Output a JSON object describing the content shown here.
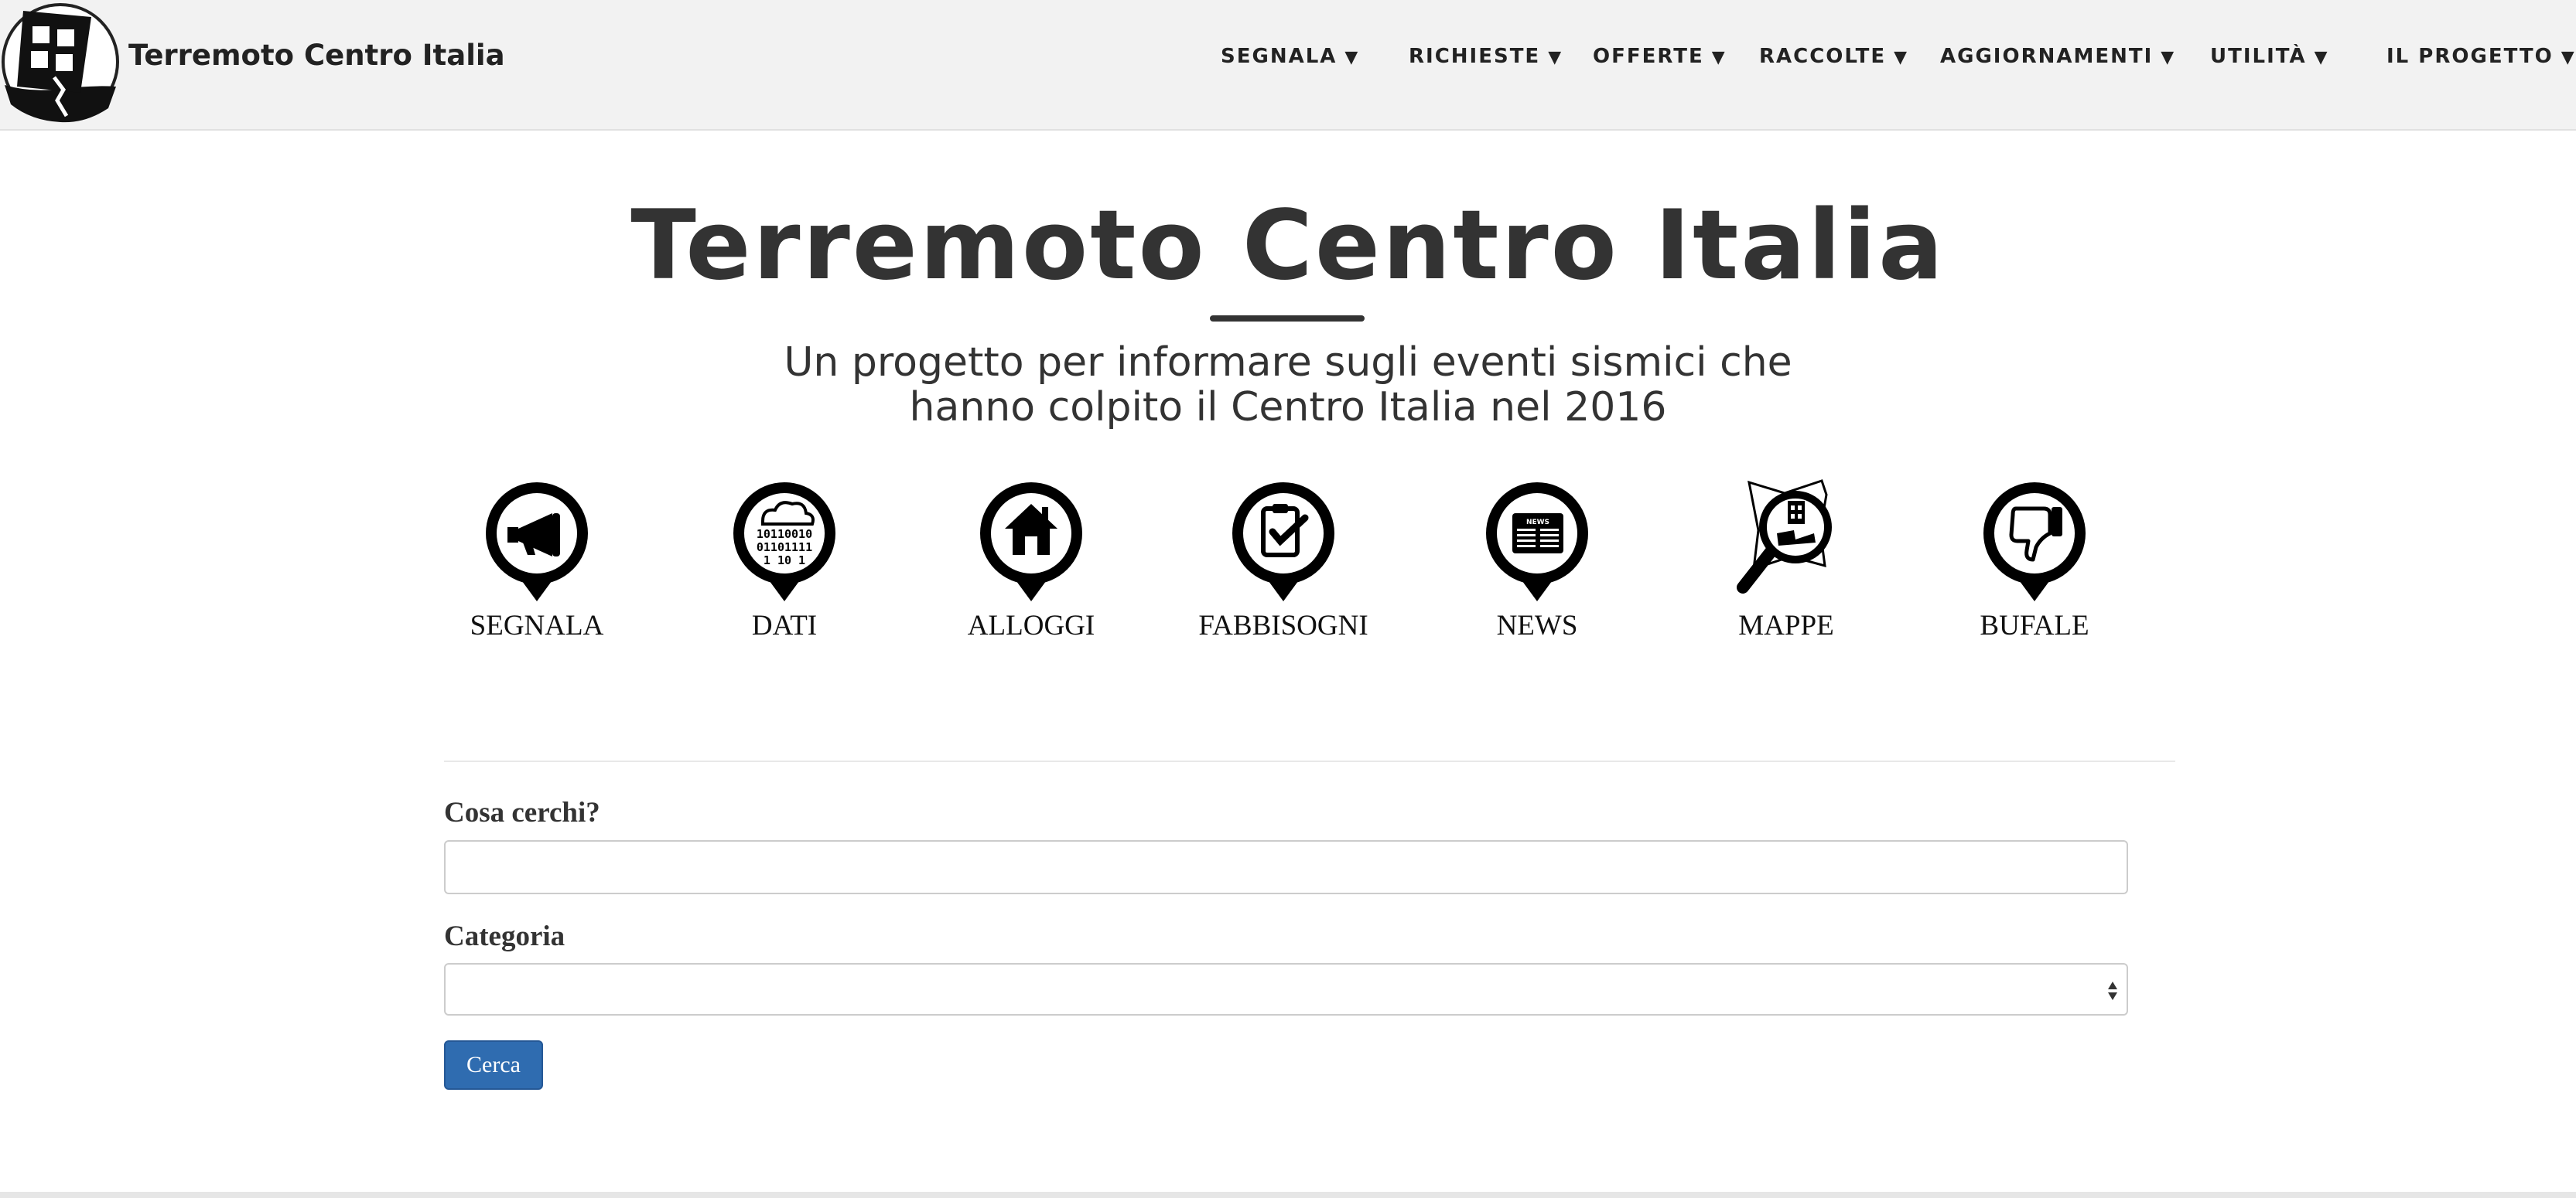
{
  "header": {
    "brand": "Terremoto Centro Italia",
    "nav": [
      {
        "label": "SEGNALA",
        "caret": "▼"
      },
      {
        "label": "RICHIESTE",
        "caret": "▼"
      },
      {
        "label": "OFFERTE",
        "caret": "▼"
      },
      {
        "label": "RACCOLTE",
        "caret": "▼"
      },
      {
        "label": "AGGIORNAMENTI",
        "caret": "▼"
      },
      {
        "label": "UTILITÀ",
        "caret": "▼"
      },
      {
        "label": "IL PROGETTO",
        "caret": "▼"
      }
    ]
  },
  "hero": {
    "title": "Terremoto Centro Italia",
    "subtitle": "Un progetto per informare sugli eventi sismici che hanno colpito il Centro Italia nel 2016"
  },
  "categories": [
    {
      "label": "SEGNALA",
      "icon": "megaphone-icon"
    },
    {
      "label": "DATI",
      "icon": "data-cloud-icon",
      "icon_text": [
        "10110010",
        "01101111",
        "1 10 1"
      ]
    },
    {
      "label": "ALLOGGI",
      "icon": "house-icon"
    },
    {
      "label": "FABBISOGNI",
      "icon": "clipboard-check-icon"
    },
    {
      "label": "NEWS",
      "icon": "newspaper-icon",
      "icon_text": "NEWS"
    },
    {
      "label": "MAPPE",
      "icon": "map-magnifier-icon"
    },
    {
      "label": "BUFALE",
      "icon": "thumbs-down-icon"
    }
  ],
  "search": {
    "query_label": "Cosa cerchi?",
    "query_value": "",
    "category_label": "Categoria",
    "category_selected": "",
    "submit_label": "Cerca"
  },
  "colors": {
    "header_bg": "#f2f2f2",
    "button_bg": "#2f6cb0",
    "text": "#333333"
  }
}
